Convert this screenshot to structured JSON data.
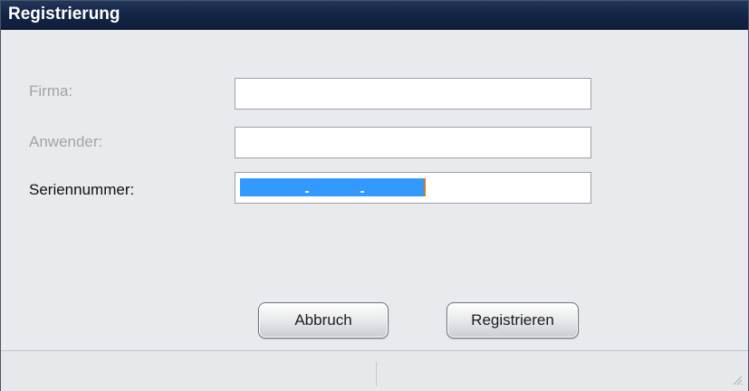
{
  "window": {
    "title": "Registrierung"
  },
  "form": {
    "firma_label": "Firma:",
    "anwender_label": "Anwender:",
    "seriennummer_label": "Seriennummer:",
    "firma_value": "",
    "anwender_value": "",
    "seriennummer_value": ""
  },
  "buttons": {
    "cancel_label": "Abbruch",
    "register_label": "Registrieren"
  },
  "colors": {
    "titlebar": "#142647",
    "selection": "#3399ff",
    "dialog_background": "#e8eaee"
  },
  "icons": {
    "resize_grip": "resize-grip-icon"
  }
}
